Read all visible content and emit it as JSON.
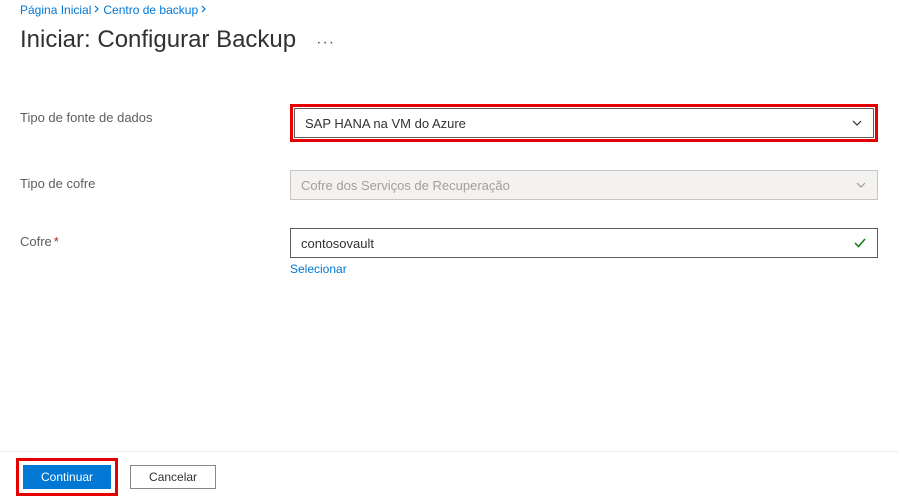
{
  "breadcrumb": {
    "items": [
      {
        "label": "Página Inicial"
      },
      {
        "label": "Centro de backup"
      }
    ]
  },
  "header": {
    "title": "Iniciar: Configurar Backup",
    "more": "···"
  },
  "form": {
    "datasource": {
      "label": "Tipo de fonte de dados",
      "value": "SAP HANA na VM do Azure"
    },
    "vaulttype": {
      "label": "Tipo de cofre",
      "value": "Cofre dos Serviços de Recuperação"
    },
    "vault": {
      "label": "Cofre",
      "value": "contosovault",
      "link": "Selecionar"
    }
  },
  "footer": {
    "primary": "Continuar",
    "secondary": "Cancelar"
  }
}
